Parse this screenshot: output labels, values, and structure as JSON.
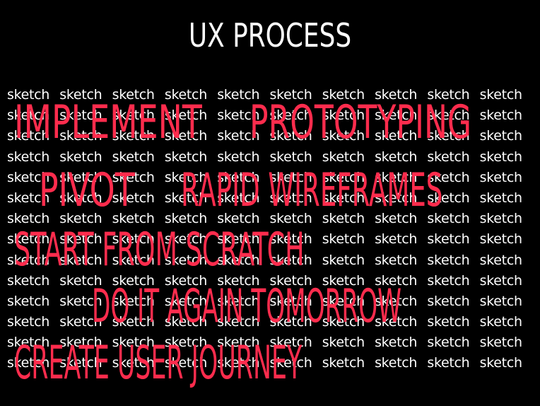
{
  "title": "UX PROCESS",
  "background_word": "sketch",
  "background_rows": 14,
  "background_cols": 10,
  "colors": {
    "background": "#000000",
    "background_text": "#ffffff",
    "title": "#ffffff",
    "overlay_text": "#ff2c4d"
  },
  "overlay_phrases": [
    "IMPLEMENT",
    "PROTOTYPING",
    "PIVOT",
    "RAPID WIREFRAMES",
    "START FROM SCRATCH",
    "DO IT AGAIN TOMORROW",
    "CREATE USER JOURNEY"
  ]
}
